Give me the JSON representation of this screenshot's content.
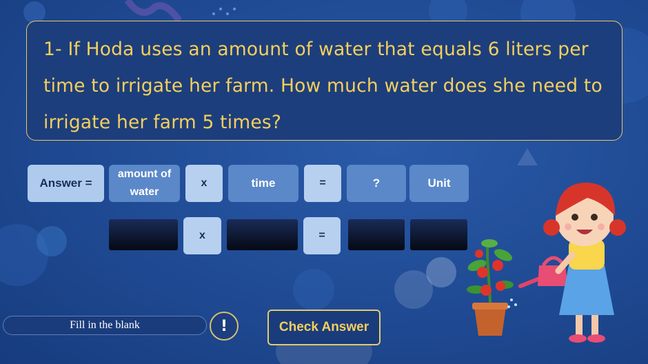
{
  "question": {
    "text": "1- If Hoda uses an amount of water that equals 6 liters per time to irrigate her farm. How much water does she need to irrigate her farm 5 times?"
  },
  "formula_row": {
    "answer_label": "Answer =",
    "amount_label": "amount of water",
    "multiply_symbol": "x",
    "time_label": "time",
    "equals_symbol": "=",
    "result_label": "?",
    "unit_label": "Unit"
  },
  "input_row": {
    "multiply_symbol": "x",
    "equals_symbol": "="
  },
  "footer": {
    "hint_text": "Fill in the blank",
    "info_symbol": "!",
    "check_label": "Check Answer"
  },
  "colors": {
    "accent_yellow": "#f4cf5c",
    "panel_blue": "#1d3e7c",
    "tile_light": "#aecbee",
    "tile_mid": "#5b88c9"
  }
}
